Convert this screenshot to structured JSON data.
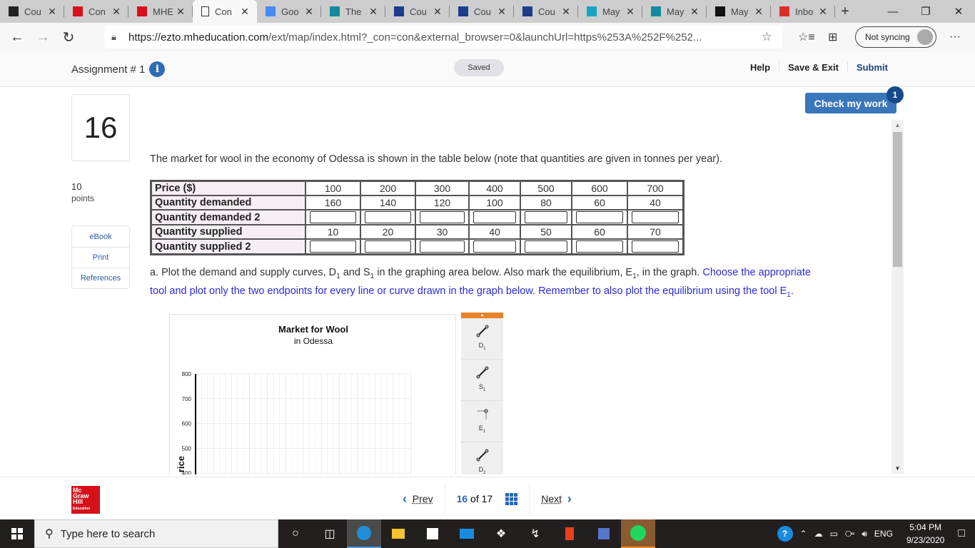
{
  "browser": {
    "tabs": [
      {
        "title": "Cou",
        "icon": "blackboard-icon",
        "color": "#222222",
        "active": false
      },
      {
        "title": "Con",
        "icon": "mcgraw-hill-icon",
        "color": "#d6111a",
        "active": false
      },
      {
        "title": "MHE",
        "icon": "m-logo-icon",
        "color": "#d6111a",
        "active": false
      },
      {
        "title": "Con",
        "icon": "page-icon",
        "color": "#ffffff",
        "active": true
      },
      {
        "title": "Goo",
        "icon": "google-translate-icon",
        "color": "#4a8af4",
        "active": false
      },
      {
        "title": "The",
        "icon": "bing-icon",
        "color": "#138a9e",
        "active": false
      },
      {
        "title": "Cou",
        "icon": "shield-star-icon",
        "color": "#1c3c8c",
        "active": false
      },
      {
        "title": "Cou",
        "icon": "shield-star-icon",
        "color": "#1c3c8c",
        "active": false
      },
      {
        "title": "Cou",
        "icon": "shield-star-icon",
        "color": "#1c3c8c",
        "active": false
      },
      {
        "title": "May",
        "icon": "question-icon",
        "color": "#19a4c4",
        "active": false
      },
      {
        "title": "May",
        "icon": "bing-icon",
        "color": "#138a9e",
        "active": false
      },
      {
        "title": "May",
        "icon": "b-logo-icon",
        "color": "#111111",
        "active": false
      },
      {
        "title": "Inbo",
        "icon": "gmail-icon",
        "color": "#d93025",
        "active": false
      }
    ],
    "new_tab": "+",
    "url_domain": "https://ezto.mheducation.com",
    "url_rest": "/ext/map/index.html?_con=con&external_browser=0&launchUrl=https%253A%252F%252...",
    "sync_label": "Not syncing",
    "more": "···"
  },
  "app": {
    "assignment_title": "Assignment # 1",
    "saved_label": "Saved",
    "help": "Help",
    "save_exit": "Save & Exit",
    "submit": "Submit",
    "check_my_work": "Check my work",
    "check_badge": "1"
  },
  "question": {
    "number": "16",
    "points_value": "10",
    "points_label": "points",
    "side_buttons": [
      "eBook",
      "Print",
      "References"
    ],
    "prompt": "The market for wool in the economy of Odessa is shown in the table below (note that quantities are given in tonnes per year).",
    "table": {
      "rows": [
        {
          "label": "Price ($)",
          "values": [
            "100",
            "200",
            "300",
            "400",
            "500",
            "600",
            "700"
          ],
          "input": false
        },
        {
          "label": "Quantity demanded",
          "values": [
            "160",
            "140",
            "120",
            "100",
            "80",
            "60",
            "40"
          ],
          "input": false
        },
        {
          "label": "Quantity demanded 2",
          "values": [
            "",
            "",
            "",
            "",
            "",
            "",
            ""
          ],
          "input": true
        },
        {
          "label": "Quantity supplied",
          "values": [
            "10",
            "20",
            "30",
            "40",
            "50",
            "60",
            "70"
          ],
          "input": false
        },
        {
          "label": "Quantity supplied 2",
          "values": [
            "",
            "",
            "",
            "",
            "",
            "",
            ""
          ],
          "input": true
        }
      ]
    },
    "instr_a": "a. Plot the demand and supply curves, D",
    "instr_b": " and S",
    "instr_c": " in the graphing area below.  Also mark the equilibrium, E",
    "instr_d": ", in the graph. ",
    "instr_blue_1": "Choose the appropriate tool and plot only the two endpoints for every line or curve drawn in the graph below. Remember to also plot the equilibrium using the tool E",
    "instr_blue_2": ".",
    "sub1": "1"
  },
  "graph": {
    "title": "Market for Wool",
    "subtitle": "in Odessa",
    "ylabel_visible": "rice",
    "tools": [
      {
        "label": "D",
        "sub": "1",
        "icon": "line-tool-icon"
      },
      {
        "label": "S",
        "sub": "1",
        "icon": "line-tool-icon"
      },
      {
        "label": "E",
        "sub": "1",
        "icon": "point-tool-icon"
      },
      {
        "label": "D",
        "sub": "2",
        "icon": "line-tool-icon"
      }
    ]
  },
  "chart_data": {
    "type": "line",
    "title": "Market for Wool",
    "subtitle": "in Odessa",
    "xlabel": "",
    "ylabel": "Price",
    "ylim": [
      0,
      800
    ],
    "visible_y_ticks": [
      800,
      700,
      600,
      500,
      400
    ],
    "grid": true,
    "series": []
  },
  "footer": {
    "prev": "Prev",
    "current": "16",
    "of": "of 17",
    "next": "Next"
  },
  "taskbar": {
    "search_placeholder": "Type here to search",
    "lang": "ENG",
    "time": "5:04 PM",
    "date": "9/23/2020"
  }
}
